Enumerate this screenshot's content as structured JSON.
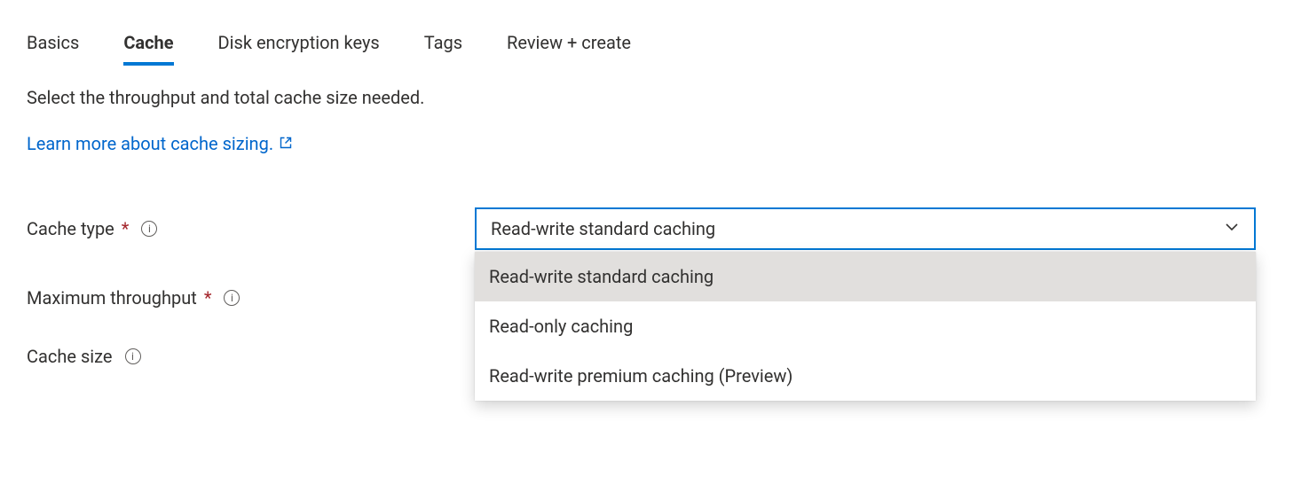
{
  "tabs": {
    "items": [
      {
        "label": "Basics"
      },
      {
        "label": "Cache"
      },
      {
        "label": "Disk encryption keys"
      },
      {
        "label": "Tags"
      },
      {
        "label": "Review + create"
      }
    ],
    "activeIndex": 1
  },
  "description": "Select the throughput and total cache size needed.",
  "learn_link": "Learn more about cache sizing.",
  "fields": {
    "cache_type": {
      "label": "Cache type",
      "required_marker": "*",
      "selected": "Read-write standard caching",
      "options": [
        "Read-write standard caching",
        "Read-only caching",
        "Read-write premium caching (Preview)"
      ]
    },
    "max_throughput": {
      "label": "Maximum throughput",
      "required_marker": "*"
    },
    "cache_size": {
      "label": "Cache size"
    }
  }
}
